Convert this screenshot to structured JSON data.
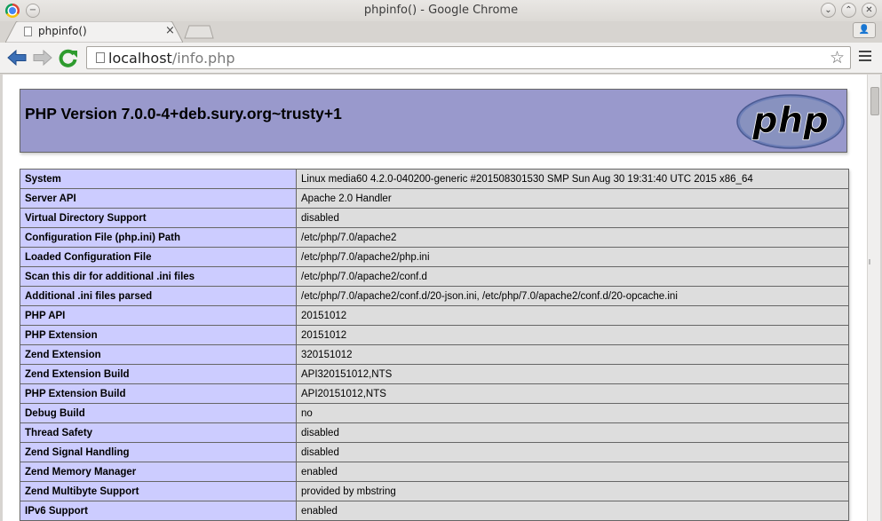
{
  "window": {
    "title": "phpinfo() - Google Chrome",
    "min_left_glyph": "−",
    "minimize_glyph": "⌄",
    "maximize_glyph": "⌃",
    "close_glyph": "✕"
  },
  "tab": {
    "title": "phpinfo()",
    "close_glyph": "×"
  },
  "toolbar": {
    "url_host": "localhost",
    "url_path": "/info.php",
    "star_glyph": "☆",
    "profile_glyph": "👤"
  },
  "php": {
    "version_title": "PHP Version 7.0.0-4+deb.sury.org~trusty+1",
    "logo_text": "php"
  },
  "info_rows": [
    {
      "name": "System",
      "value": "Linux media60 4.2.0-040200-generic #201508301530 SMP Sun Aug 30 19:31:40 UTC 2015 x86_64"
    },
    {
      "name": "Server API",
      "value": "Apache 2.0 Handler"
    },
    {
      "name": "Virtual Directory Support",
      "value": "disabled"
    },
    {
      "name": "Configuration File (php.ini) Path",
      "value": "/etc/php/7.0/apache2"
    },
    {
      "name": "Loaded Configuration File",
      "value": "/etc/php/7.0/apache2/php.ini"
    },
    {
      "name": "Scan this dir for additional .ini files",
      "value": "/etc/php/7.0/apache2/conf.d"
    },
    {
      "name": "Additional .ini files parsed",
      "value": "/etc/php/7.0/apache2/conf.d/20-json.ini, /etc/php/7.0/apache2/conf.d/20-opcache.ini"
    },
    {
      "name": "PHP API",
      "value": "20151012"
    },
    {
      "name": "PHP Extension",
      "value": "20151012"
    },
    {
      "name": "Zend Extension",
      "value": "320151012"
    },
    {
      "name": "Zend Extension Build",
      "value": "API320151012,NTS"
    },
    {
      "name": "PHP Extension Build",
      "value": "API20151012,NTS"
    },
    {
      "name": "Debug Build",
      "value": "no"
    },
    {
      "name": "Thread Safety",
      "value": "disabled"
    },
    {
      "name": "Zend Signal Handling",
      "value": "disabled"
    },
    {
      "name": "Zend Memory Manager",
      "value": "enabled"
    },
    {
      "name": "Zend Multibyte Support",
      "value": "provided by mbstring"
    },
    {
      "name": "IPv6 Support",
      "value": "enabled"
    }
  ],
  "colors": {
    "header_bg": "#9999cc",
    "label_cell_bg": "#ccccff",
    "value_cell_bg": "#dddddd",
    "reload_green": "#2e9b2e",
    "back_blue": "#3b6fb6"
  },
  "icons": {
    "chrome": "chrome-logo-icon",
    "back": "back-arrow-icon",
    "forward": "forward-arrow-icon",
    "reload": "reload-icon",
    "star": "star-icon",
    "menu": "hamburger-menu-icon",
    "profile": "user-icon"
  }
}
